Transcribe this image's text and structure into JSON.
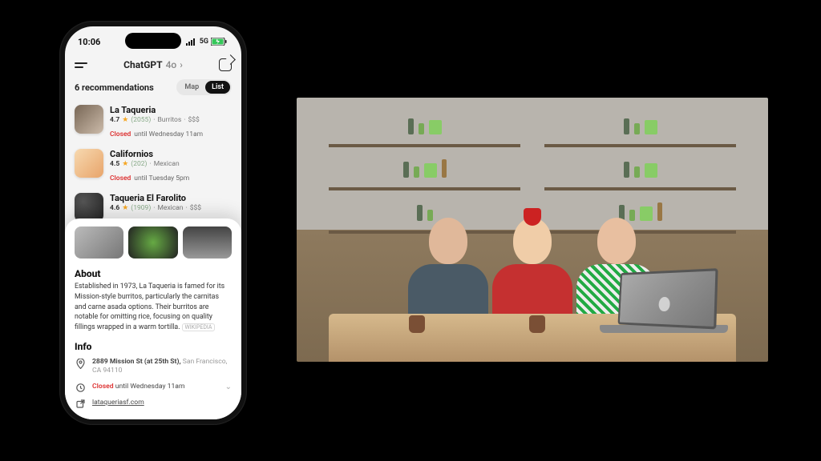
{
  "status": {
    "time": "10:06",
    "network": "5G"
  },
  "header": {
    "title": "ChatGPT",
    "subtitle": "4o"
  },
  "recommendations": {
    "count_label": "6 recommendations",
    "toggle": {
      "map": "Map",
      "list": "List"
    }
  },
  "items": [
    {
      "name": "La Taqueria",
      "rating": "4.7",
      "reviews": "(2055)",
      "category": "Burritos",
      "price": "$$$",
      "status": "Closed",
      "until": "until Wednesday 11am"
    },
    {
      "name": "Californios",
      "rating": "4.5",
      "reviews": "(202)",
      "category": "Mexican",
      "price": "",
      "status": "Closed",
      "until": "until Tuesday 5pm"
    },
    {
      "name": "Taqueria El Farolito",
      "rating": "4.6",
      "reviews": "(1909)",
      "category": "Mexican",
      "price": "$$$",
      "status": "",
      "until": ""
    }
  ],
  "detail": {
    "about_heading": "About",
    "about_text": "Established in 1973, La Taqueria is famed for its Mission-style burritos, particularly the carnitas and carne asada options. Their burritos are notable for omitting rice, focusing on quality fillings wrapped in a warm tortilla.",
    "about_source": "WIKIPEDIA",
    "info_heading": "Info",
    "address_main": "2889 Mission St (at 25th St),",
    "address_sub": "San Francisco, CA 94110",
    "hours_status": "Closed",
    "hours_until": "until Wednesday 11am",
    "website": "lataqueriasf.com"
  }
}
